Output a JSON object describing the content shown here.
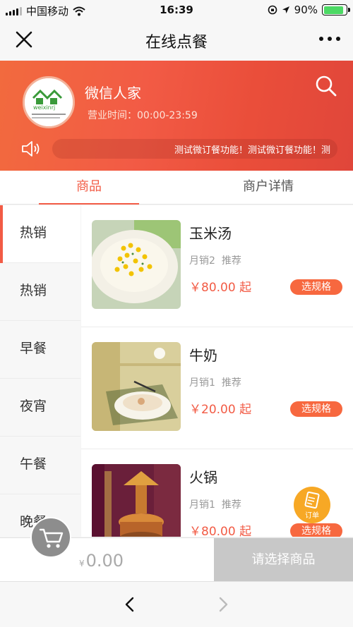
{
  "status": {
    "carrier": "中国移动",
    "time": "16:39",
    "battery": "90%",
    "battery_level": 0.9
  },
  "nav": {
    "title": "在线点餐"
  },
  "shop": {
    "name": "微信人家",
    "hours": "营业时间：00:00-23:59",
    "notice": "测试微订餐功能！测试微订餐功能！测"
  },
  "tabs": [
    {
      "label": "商品"
    },
    {
      "label": "商户详情"
    }
  ],
  "categories": [
    {
      "label": "热销"
    },
    {
      "label": "热销"
    },
    {
      "label": "早餐"
    },
    {
      "label": "夜宵"
    },
    {
      "label": "午餐"
    },
    {
      "label": "晚餐"
    }
  ],
  "products": [
    {
      "name": "玉米汤",
      "sales": "月销2",
      "tag": "推荐",
      "price": "￥80.00 起",
      "spec": "选规格"
    },
    {
      "name": "牛奶",
      "sales": "月销1",
      "tag": "推荐",
      "price": "￥20.00 起",
      "spec": "选规格"
    },
    {
      "name": "火锅",
      "sales": "月销1",
      "tag": "推荐",
      "price": "￥80.00 起",
      "spec": "选规格"
    }
  ],
  "cart": {
    "currency": "¥",
    "total": "0.00",
    "checkout": "请选择商品",
    "order_label": "订单"
  },
  "colors": {
    "accent": "#f25b45",
    "spec_button": "#f7683f",
    "order_button": "#f7a825"
  }
}
